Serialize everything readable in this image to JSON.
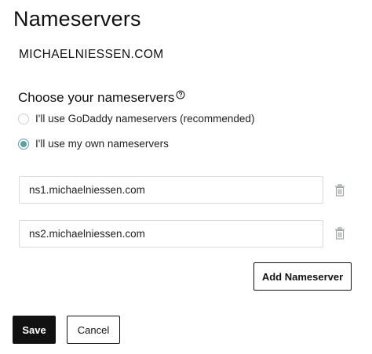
{
  "header": {
    "title": "Nameservers"
  },
  "domain": {
    "name": "MICHAELNIESSEN.COM"
  },
  "nameserver_choice": {
    "label": "Choose your nameservers",
    "options": [
      {
        "label": "I'll use GoDaddy nameservers (recommended)",
        "selected": false
      },
      {
        "label": "I'll use my own nameservers",
        "selected": true
      }
    ]
  },
  "nameservers": [
    {
      "value": "ns1.michaelniessen.com"
    },
    {
      "value": "ns2.michaelniessen.com"
    }
  ],
  "actions": {
    "add_label": "Add Nameserver",
    "save_label": "Save",
    "cancel_label": "Cancel"
  },
  "colors": {
    "accent": "#5aa0a6",
    "primary_button": "#111111"
  },
  "icons": {
    "help": "question-circle-icon",
    "delete": "trash-icon"
  }
}
